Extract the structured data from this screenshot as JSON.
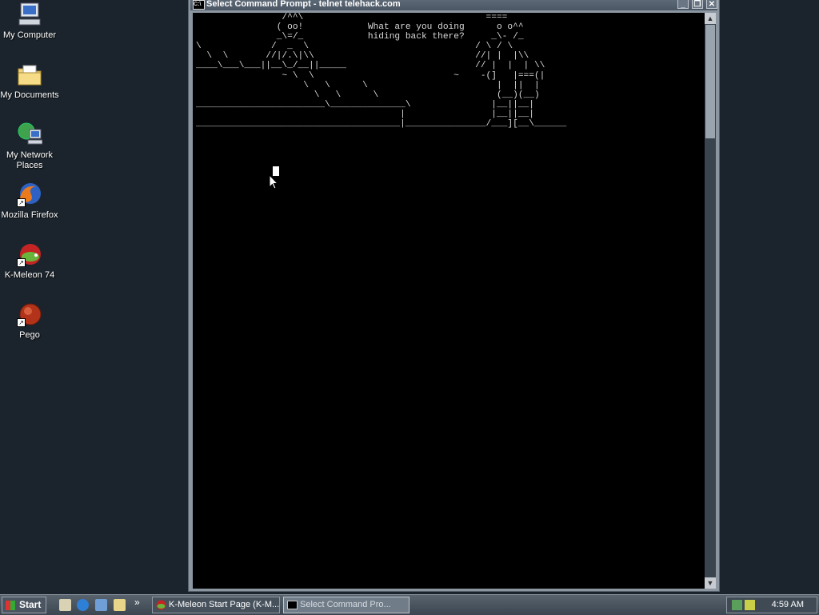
{
  "desktop": {
    "icons": [
      {
        "label_line1": "My Computer",
        "label_line2": ""
      },
      {
        "label_line1": "My Documents",
        "label_line2": ""
      },
      {
        "label_line1": "My Network",
        "label_line2": "Places"
      },
      {
        "label_line1": "Mozilla Firefox",
        "label_line2": ""
      },
      {
        "label_line1": "K-Meleon 74",
        "label_line2": ""
      },
      {
        "label_line1": "Pego",
        "label_line2": ""
      }
    ]
  },
  "window": {
    "title": "Select Command Prompt - telnet telehack.com",
    "icon_text": "C:\\",
    "minimize": "_",
    "restore": "❐",
    "close": "✕",
    "scroll_up": "▲",
    "scroll_down": "▼"
  },
  "console": {
    "lines": [
      "                /^^\\                                  ====",
      "               ( oo!            What are you doing      o o^^",
      "               _\\=/_            hiding back there?     _\\- /_",
      "\\             /  _  \\                               / \\ / \\",
      "  \\  \\       //|/.\\|\\\\                              //| |  |\\\\",
      "____\\___\\___||__\\_/__||_____                        // |  |  | \\\\",
      "                ~ \\  \\                          ~    -(]   |===(|",
      "                    \\   \\      \\                        |  ||  |",
      "                      \\   \\      \\                      (__)(__)",
      "________________________\\______________\\               |__||__|",
      "                                      |                |__||__|",
      "______________________________________|_______________/___][__\\______"
    ]
  },
  "taskbar": {
    "start_label": "Start",
    "more": "»",
    "tasks": [
      {
        "label": "K-Meleon Start Page (K-M..."
      },
      {
        "label": "Select Command Pro..."
      }
    ],
    "clock": "4:59 AM"
  }
}
